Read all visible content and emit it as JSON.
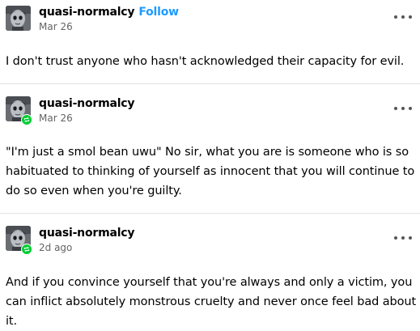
{
  "posts": [
    {
      "blog_name": "quasi-normalcy",
      "follow_label": "Follow",
      "date": "Mar 26",
      "reblogged": false,
      "body": "I don't trust anyone who hasn't acknowledged their capacity for evil."
    },
    {
      "blog_name": "quasi-normalcy",
      "date": "Mar 26",
      "reblogged": true,
      "body": "\"I'm just a smol bean uwu\" No sir, what you are is someone who is so habituated to thinking of yourself as innocent that you will continue to do so even when you're guilty."
    },
    {
      "blog_name": "quasi-normalcy",
      "date": "2d ago",
      "reblogged": true,
      "body": "And if you convince yourself that you're always and only a victim, you can inflict absolutely monstrous cruelty and never once feel bad about it."
    }
  ],
  "icons": {
    "more": "more-options-icon",
    "reblog": "reblog-icon",
    "avatar": "avatar"
  },
  "colors": {
    "follow_link": "#1e9bff",
    "reblog_badge": "#00cf35",
    "date_text": "#646464",
    "divider": "#e2e2e2"
  }
}
